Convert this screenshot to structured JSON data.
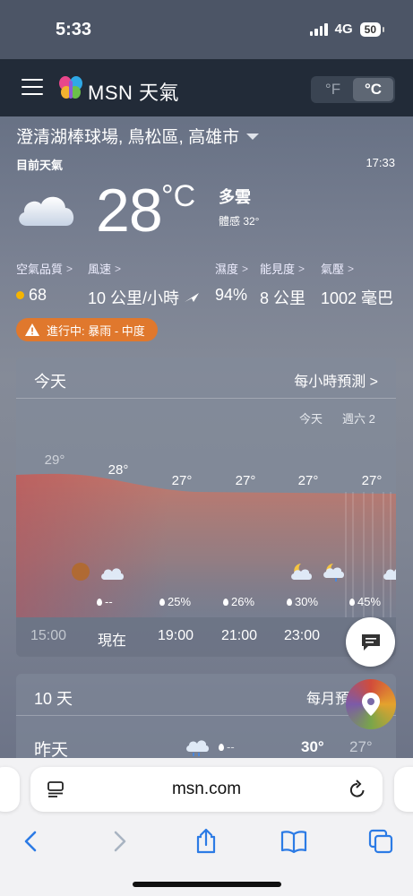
{
  "status": {
    "time": "5:33",
    "network": "4G",
    "battery": "50"
  },
  "header": {
    "title": "MSN 天氣",
    "unit_f": "°F",
    "unit_c": "°C"
  },
  "location": "澄清湖棒球場, 鳥松區, 高雄市",
  "current": {
    "label": "目前天氣",
    "time": "17:33",
    "temp": "28",
    "unit": "°C",
    "condition": "多雲",
    "feels_like": "體感 32°"
  },
  "metrics": [
    {
      "label": "空氣品質",
      "value": "68"
    },
    {
      "label": "風速",
      "value": "10 公里/小時"
    },
    {
      "label": "濕度",
      "value": "94%"
    },
    {
      "label": "能見度",
      "value": "8 公里"
    },
    {
      "label": "氣壓",
      "value": "1002 毫巴"
    }
  ],
  "alert": "進行中: 暴雨 - 中度",
  "today": {
    "title": "今天",
    "hourly_link": "每小時預測",
    "day_label_today": "今天",
    "day_label_next": "週六 2",
    "hours": [
      {
        "time": "15:00",
        "temp": "29°",
        "precip": ""
      },
      {
        "time": "現在",
        "temp": "28°",
        "precip": "--"
      },
      {
        "time": "19:00",
        "temp": "27°",
        "precip": "25%"
      },
      {
        "time": "21:00",
        "temp": "27°",
        "precip": "26%"
      },
      {
        "time": "23:00",
        "temp": "27°",
        "precip": "30%"
      },
      {
        "time": "",
        "temp": "27°",
        "precip": "45%"
      }
    ]
  },
  "ten_day": {
    "title": "10 天",
    "monthly_link": "每月預",
    "rows": [
      {
        "day": "昨天",
        "precip": "--",
        "high": "30°",
        "low": "27°"
      }
    ]
  },
  "browser": {
    "url": "msn.com"
  }
}
